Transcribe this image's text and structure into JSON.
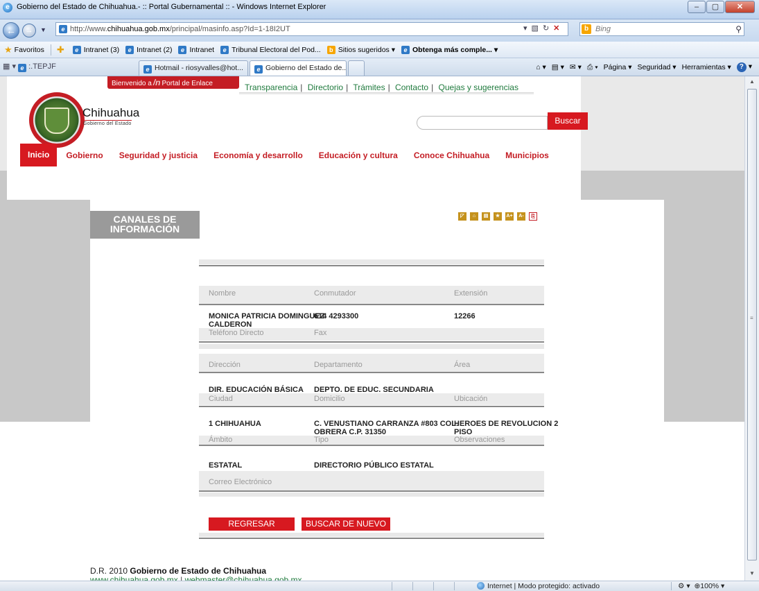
{
  "browser": {
    "window_title": "Gobierno del Estado de Chihuahua.- :: Portal Gubernamental :: - Windows Internet Explorer",
    "url_prefix": "http://www.",
    "url_domain": "chihuahua.gob.mx",
    "url_path": "/principal/masinfo.asp?Id=1-18I2UT",
    "search_placeholder": "Bing",
    "favorites_label": "Favoritos",
    "favorites": [
      "Intranet (3)",
      "Intranet (2)",
      "Intranet",
      "Tribunal Electoral del Pod...",
      "Sitios sugeridos ▾",
      "Obtenga más comple... ▾"
    ],
    "quick_tab_label": ":.TEPJF",
    "tabs": [
      "Hotmail - riosyvalles@hot...",
      "Gobierno del Estado de..."
    ],
    "commands": [
      "Página ▾",
      "Seguridad ▾",
      "Herramientas ▾"
    ],
    "status_zone": "Internet | Modo protegido: activado",
    "zoom": "100%"
  },
  "site": {
    "welcome_prefix": "Bienvenido a",
    "welcome_suffix": "Portal de Enlace",
    "top_links": [
      "Transparencia",
      "Directorio",
      "Trámites",
      "Contacto",
      "Quejas y sugerencias"
    ],
    "logo_name": "Chihuahua",
    "logo_sub": "Gobierno del Estado",
    "search_button": "Buscar",
    "main_nav": [
      "Inicio",
      "Gobierno",
      "Seguridad y justicia",
      "Economía y desarrollo",
      "Educación y cultura",
      "Conoce Chihuahua",
      "Municipios"
    ],
    "section_title_line1": "CANALES DE",
    "section_title_line2": "INFORMACIÓN",
    "tool_icons": [
      "back-icon",
      "home-icon",
      "print-icon",
      "favorite-icon",
      "font-increase-icon",
      "font-decrease-icon",
      "pdf-icon"
    ]
  },
  "record": {
    "labels": {
      "nombre": "Nombre",
      "conmutador": "Conmutador",
      "extension": "Extensión",
      "telefono": "Teléfono Directo",
      "fax": "Fax",
      "direccion": "Dirección",
      "departamento": "Departamento",
      "area": "Área",
      "ciudad": "Ciudad",
      "domicilio": "Domicilio",
      "ubicacion": "Ubicación",
      "ambito": "Ámbito",
      "tipo": "Tipo",
      "observaciones": "Observaciones",
      "correo": "Correo Electrónico"
    },
    "values": {
      "nombre_1": "MONICA PATRICIA DOMINGUEZ",
      "nombre_2": "CALDERON",
      "conmutador": "614 4293300",
      "extension": "12266",
      "direccion": "DIR. EDUCACIÓN BÁSICA",
      "departamento": "DEPTO. DE EDUC. SECUNDARIA",
      "ciudad": "1 CHIHUAHUA",
      "domicilio_1": "C. VENUSTIANO CARRANZA #803 COL.",
      "domicilio_2": "OBRERA C.P. 31350",
      "ubicacion_1": "HEROES DE REVOLUCION 2",
      "ubicacion_2": "PISO",
      "ambito": "ESTATAL",
      "tipo": "DIRECTORIO PÚBLICO ESTATAL"
    },
    "buttons": {
      "back": "REGRESAR",
      "search_again": "BUSCAR DE NUEVO"
    }
  },
  "footer": {
    "copyright_prefix": "D.R. 2010",
    "copyright_owner": "Gobierno de Estado de Chihuahua",
    "website": "www.chihuahua.gob.mx",
    "separator": "|",
    "email": "webmaster@chihuahua.gob.mx"
  },
  "colors": {
    "brand_red": "#d71920",
    "link_green": "#1f7a3d",
    "section_grey": "#9a9a9a"
  }
}
